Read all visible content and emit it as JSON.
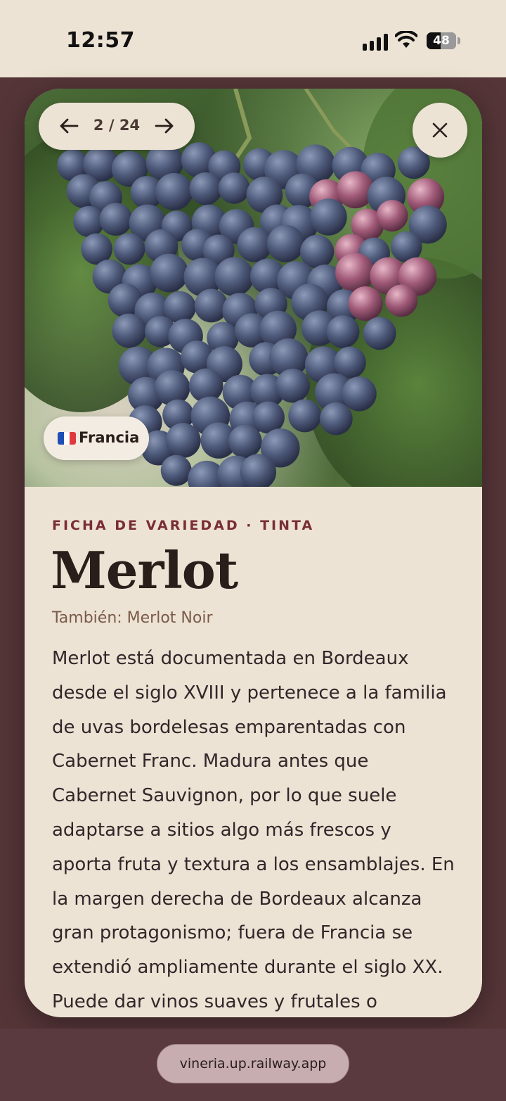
{
  "status_bar": {
    "time": "12:57",
    "battery": "48"
  },
  "viewer": {
    "counter": "2 / 24"
  },
  "photo": {
    "country": "Francia",
    "flag_colors": [
      "#1f4fb5",
      "#ffffff",
      "#e03a3e"
    ]
  },
  "variety": {
    "eyebrow": "FICHA DE VARIEDAD · TINTA",
    "name": "Merlot",
    "aka": "También: Merlot Noir",
    "description_lines": [
      "Merlot está documentada en Bordeaux",
      "desde el siglo XVIII y pertenece a la familia",
      "de uvas bordelesas emparentadas con",
      "Cabernet Franc. Madura antes que",
      "Cabernet Sauvignon, por lo que suele",
      "adaptarse a sitios algo más frescos y",
      "aporta fruta y textura a los ensamblajes. En",
      "la margen derecha de Bordeaux alcanza",
      "gran protagonismo; fuera de Francia se",
      "extendió ampliamente durante el siglo XX.",
      "Puede dar vinos suaves y frutales o"
    ]
  },
  "browser": {
    "url": "vineria.up.railway.app"
  },
  "colors": {
    "accent": "#7a2d35",
    "card": "#ede3d4",
    "backdrop": "#553538"
  }
}
